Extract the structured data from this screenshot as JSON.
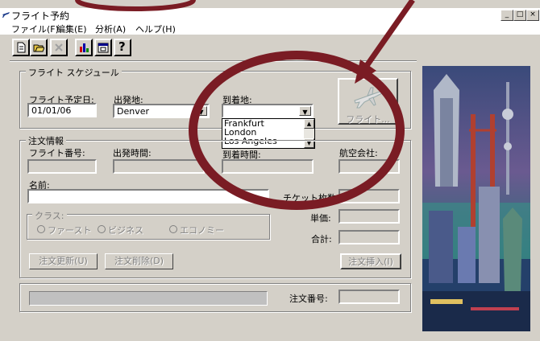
{
  "window": {
    "title": "フライト予約",
    "controls": [
      "_",
      "□",
      "×"
    ]
  },
  "menu": [
    {
      "label": "ファイル(F)"
    },
    {
      "label": "編集(E)"
    },
    {
      "label": "分析(A)"
    },
    {
      "label": "ヘルプ(H)"
    }
  ],
  "toolbar": [
    {
      "icon": "new-document-icon"
    },
    {
      "icon": "open-folder-icon"
    },
    {
      "icon": "delete-icon"
    },
    {
      "icon": "bar-chart-icon"
    },
    {
      "icon": "calendar-icon"
    },
    {
      "icon": "help-icon",
      "glyph": "?"
    }
  ],
  "schedule": {
    "legend": "フライト スケジュール",
    "date_label": "フライト予定日:",
    "date_value": "01/01/06",
    "from_label": "出発地:",
    "from_value": "Denver",
    "to_label": "到着地:",
    "to_value": "",
    "to_options": [
      "Frankfurt",
      "London",
      "Los Angeles"
    ],
    "flight_button": "フライト..."
  },
  "order": {
    "legend": "注文情報",
    "flight_no_label": "フライト番号:",
    "depart_time_label": "出発時間:",
    "arrive_time_label": "到着時間:",
    "airline_label": "航空会社:",
    "name_label": "名前:",
    "name_value": "",
    "tickets_label": "チケット枚数:",
    "price_label": "単価:",
    "total_label": "合計:",
    "class_legend": "クラス:",
    "classes": [
      "ファースト",
      "ビジネス",
      "エコノミー"
    ],
    "update_button": "注文更新(U)",
    "delete_button": "注文削除(D)",
    "insert_button": "注文挿入(I)"
  },
  "footer": {
    "order_no_label": "注文番号:",
    "progress": 0
  },
  "colors": {
    "window_bg": "#d4d0c8",
    "annotation": "#7a1c24"
  }
}
